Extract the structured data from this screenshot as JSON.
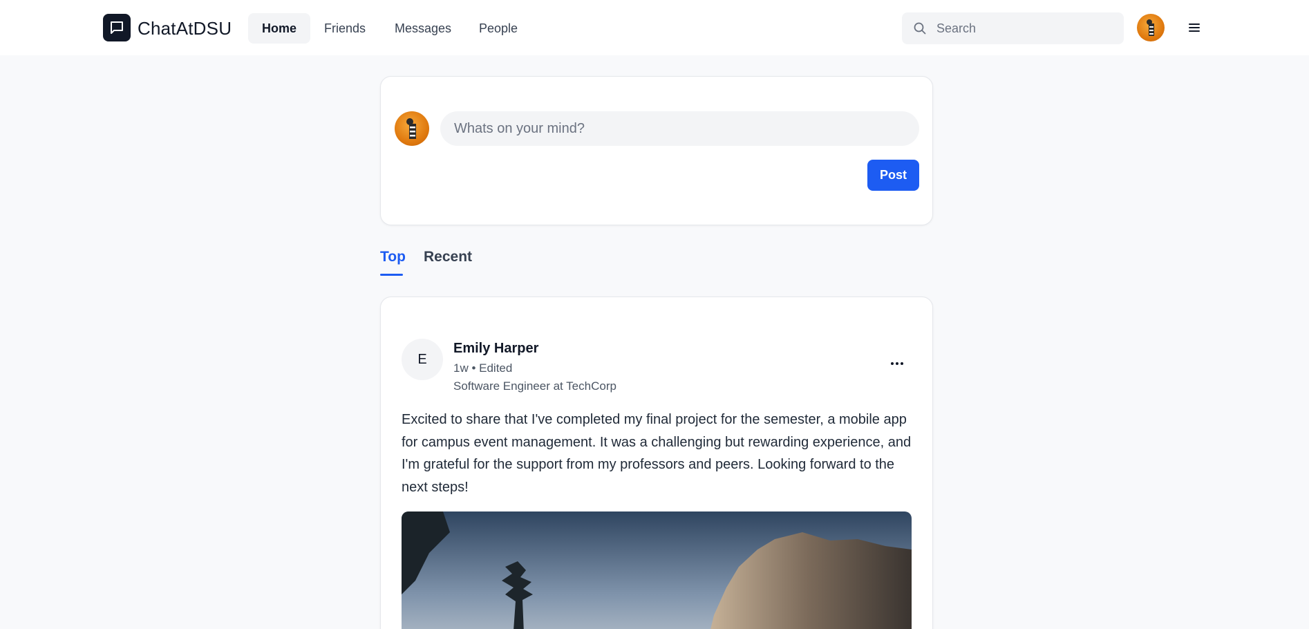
{
  "app": {
    "brand": "ChatAtDSU"
  },
  "nav": {
    "items": [
      {
        "label": "Home",
        "active": true
      },
      {
        "label": "Friends",
        "active": false
      },
      {
        "label": "Messages",
        "active": false
      },
      {
        "label": "People",
        "active": false
      }
    ]
  },
  "search": {
    "placeholder": "Search",
    "value": ""
  },
  "composer": {
    "placeholder": "Whats on your mind?",
    "post_label": "Post"
  },
  "tabs": [
    {
      "label": "Top",
      "active": true
    },
    {
      "label": "Recent",
      "active": false
    }
  ],
  "post": {
    "avatar_initial": "E",
    "author": "Emily Harper",
    "meta": "1w • Edited",
    "role": "Software Engineer at TechCorp",
    "text": "Excited to share that I've completed my final project for the semester, a mobile app for campus event management. It was a challenging but rewarding experience, and I'm grateful for the support from my professors and peers. Looking forward to the next steps!"
  },
  "colors": {
    "accent": "#1d5cf2",
    "background": "#f8f9fb",
    "logo_bg": "#111827"
  },
  "icons": {
    "logo": "chat-bubble-icon",
    "search": "search-icon",
    "menu": "hamburger-menu-icon",
    "more": "more-horizontal-icon"
  }
}
